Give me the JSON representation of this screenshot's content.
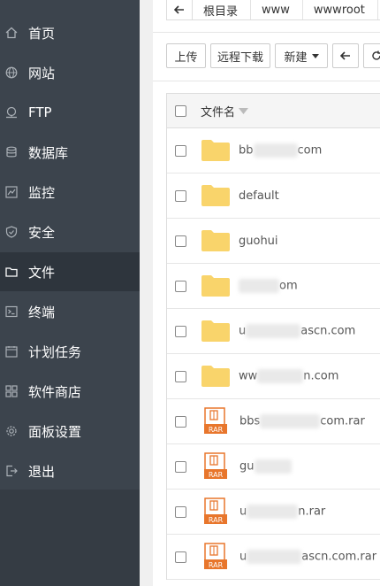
{
  "sidebar": {
    "items": [
      {
        "label": "首页",
        "icon": "home-icon"
      },
      {
        "label": "网站",
        "icon": "globe-icon"
      },
      {
        "label": "FTP",
        "icon": "ftp-icon"
      },
      {
        "label": "数据库",
        "icon": "database-icon"
      },
      {
        "label": "监控",
        "icon": "monitor-icon"
      },
      {
        "label": "安全",
        "icon": "shield-icon"
      },
      {
        "label": "文件",
        "icon": "folder-icon",
        "active": true
      },
      {
        "label": "终端",
        "icon": "terminal-icon"
      },
      {
        "label": "计划任务",
        "icon": "calendar-icon"
      },
      {
        "label": "软件商店",
        "icon": "apps-icon"
      },
      {
        "label": "面板设置",
        "icon": "gear-icon"
      },
      {
        "label": "退出",
        "icon": "logout-icon"
      }
    ]
  },
  "breadcrumb": [
    "根目录",
    "www",
    "wwwroot"
  ],
  "toolbar": {
    "upload": "上传",
    "remote_download": "远程下载",
    "new": "新建"
  },
  "table": {
    "header_name": "文件名",
    "rows": [
      {
        "type": "folder",
        "prefix": "bb",
        "suffix": "com"
      },
      {
        "type": "folder",
        "prefix": "default",
        "suffix": ""
      },
      {
        "type": "folder",
        "prefix": "guohui",
        "suffix": ""
      },
      {
        "type": "folder",
        "prefix": "",
        "suffix": "om"
      },
      {
        "type": "folder",
        "prefix": "u",
        "suffix": "ascn.com"
      },
      {
        "type": "folder",
        "prefix": "ww",
        "suffix": "n.com"
      },
      {
        "type": "rar",
        "prefix": "bbs",
        "suffix": "com.rar"
      },
      {
        "type": "rar",
        "prefix": "gu",
        "suffix": ""
      },
      {
        "type": "rar",
        "prefix": "u",
        "suffix": "n.rar"
      },
      {
        "type": "rar",
        "prefix": "u",
        "suffix": "ascn.com.rar"
      }
    ],
    "rar_label": "RAR"
  },
  "colors": {
    "sidebar": "#3c444d",
    "folder": "#f9d46b",
    "rar": "#e8762c"
  }
}
